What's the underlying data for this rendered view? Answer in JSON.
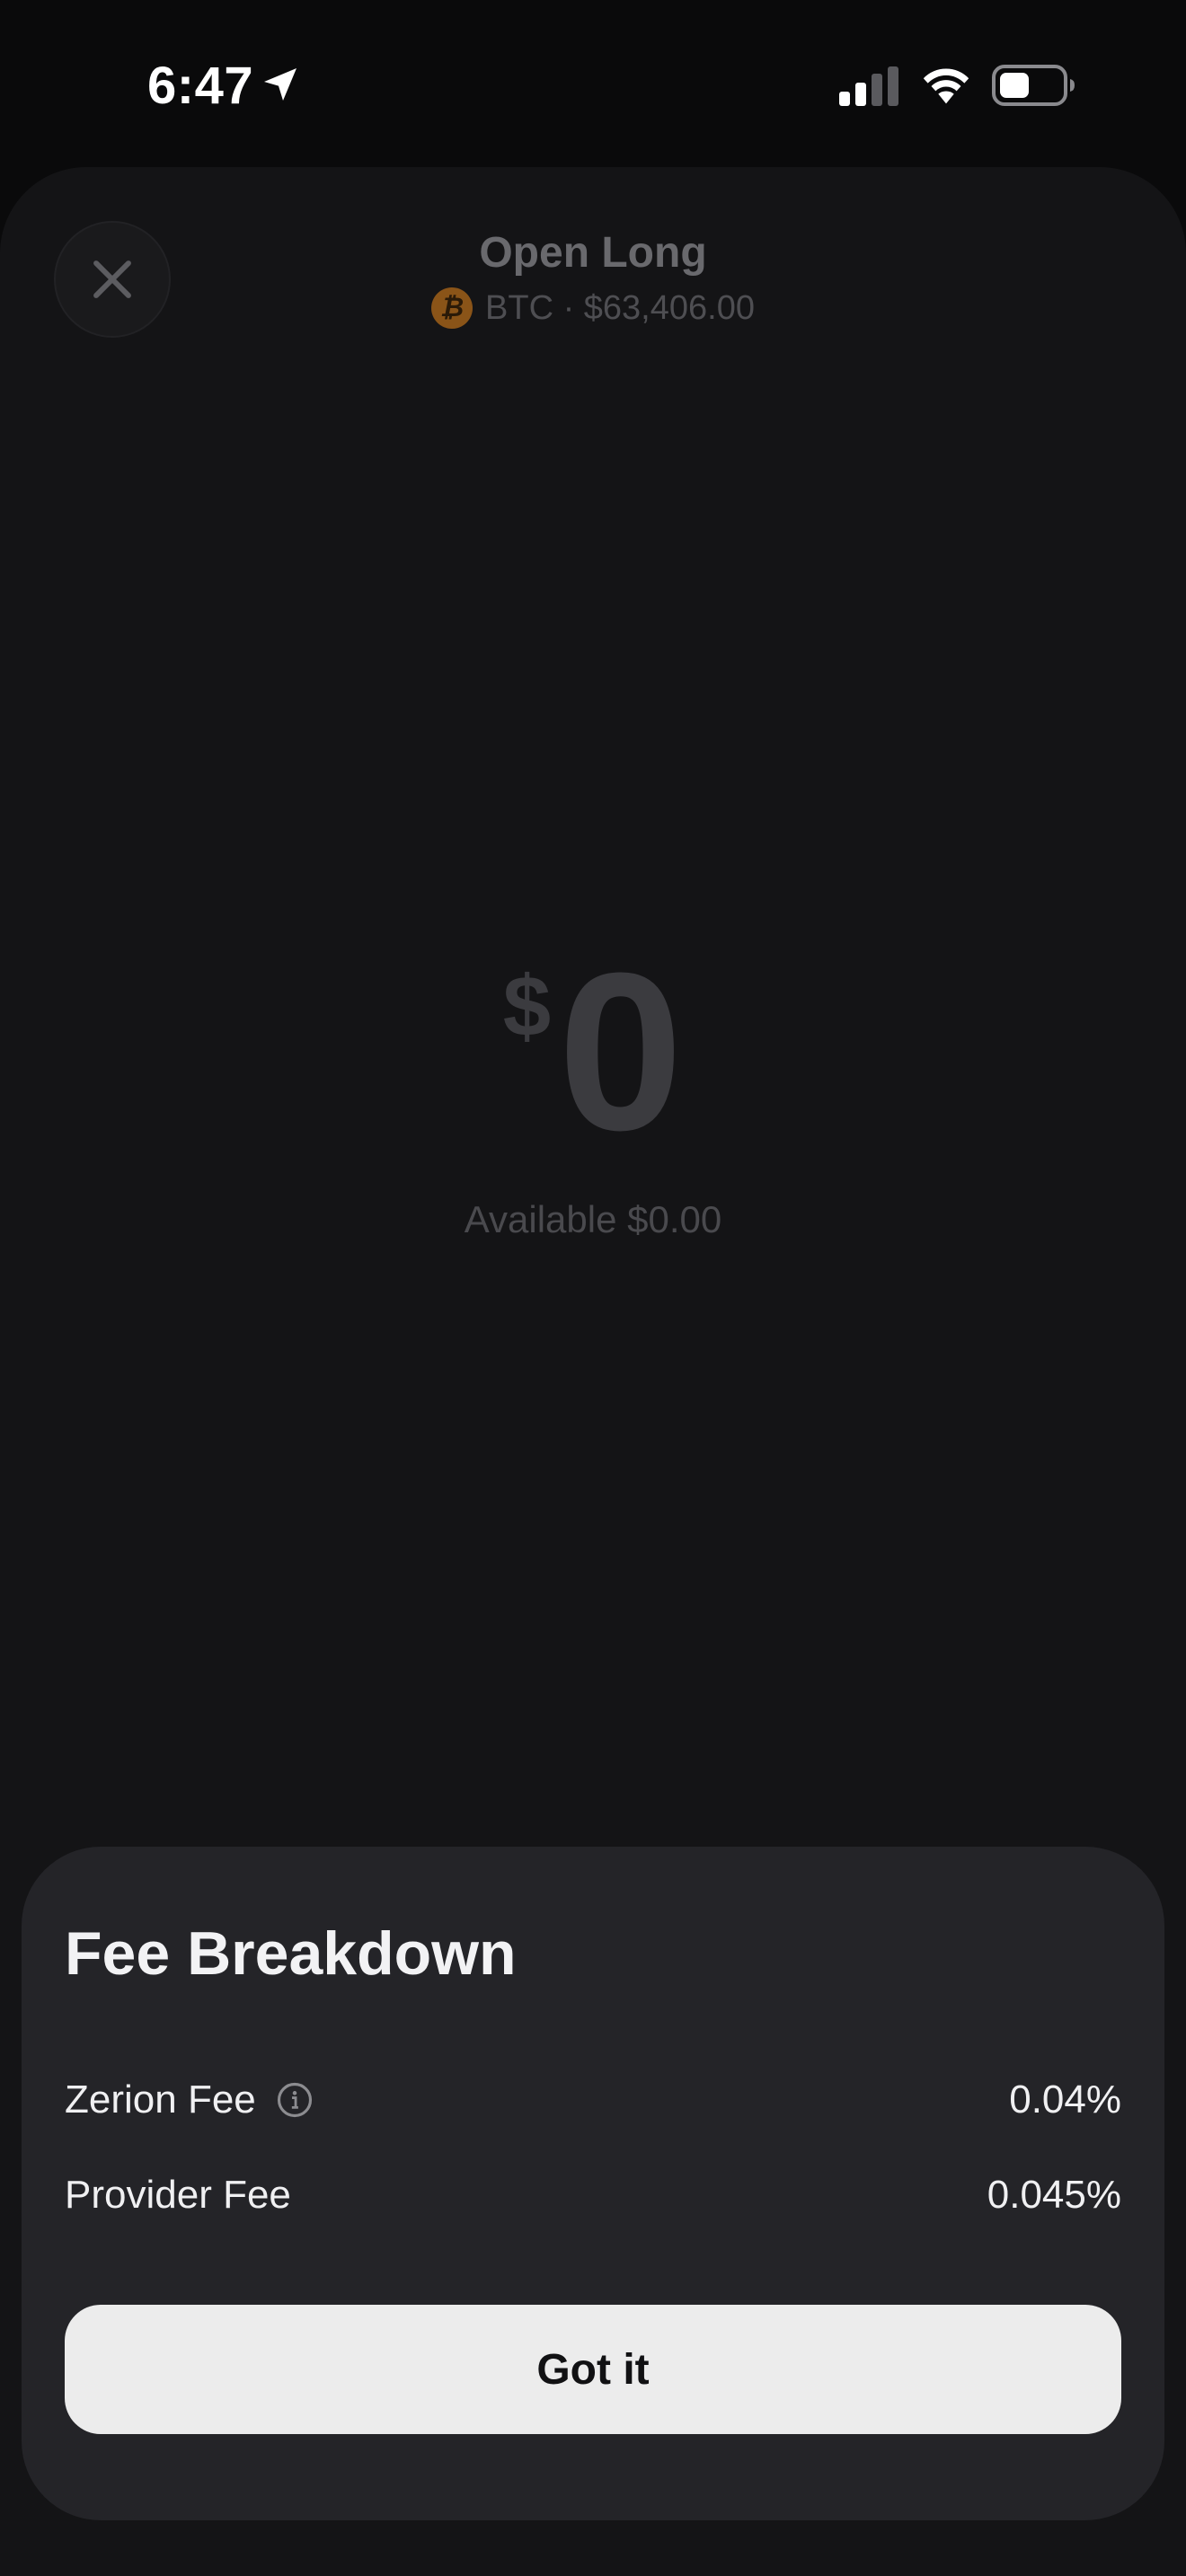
{
  "status_bar": {
    "time": "6:47",
    "icons": [
      "location-arrow-icon",
      "cellular-signal-icon",
      "wifi-icon",
      "battery-icon"
    ]
  },
  "header": {
    "title": "Open Long",
    "asset_icon": "bitcoin-icon",
    "asset_icon_glyph": "₿",
    "subtitle": "BTC · $63,406.00",
    "close_icon": "close-icon"
  },
  "amount": {
    "currency_symbol": "$",
    "value": "0",
    "available_text": "Available $0.00"
  },
  "fee_sheet": {
    "title": "Fee Breakdown",
    "rows": [
      {
        "label": "Zerion Fee",
        "value": "0.04%",
        "icon": "info-icon"
      },
      {
        "label": "Provider Fee",
        "value": "0.045%"
      }
    ],
    "button_label": "Got it"
  },
  "colors": {
    "background": "#0a0a0b",
    "sheet_background": "#141416",
    "fee_sheet_background": "#242428",
    "button_background": "#ececec",
    "bitcoin_accent": "#8a5418"
  }
}
